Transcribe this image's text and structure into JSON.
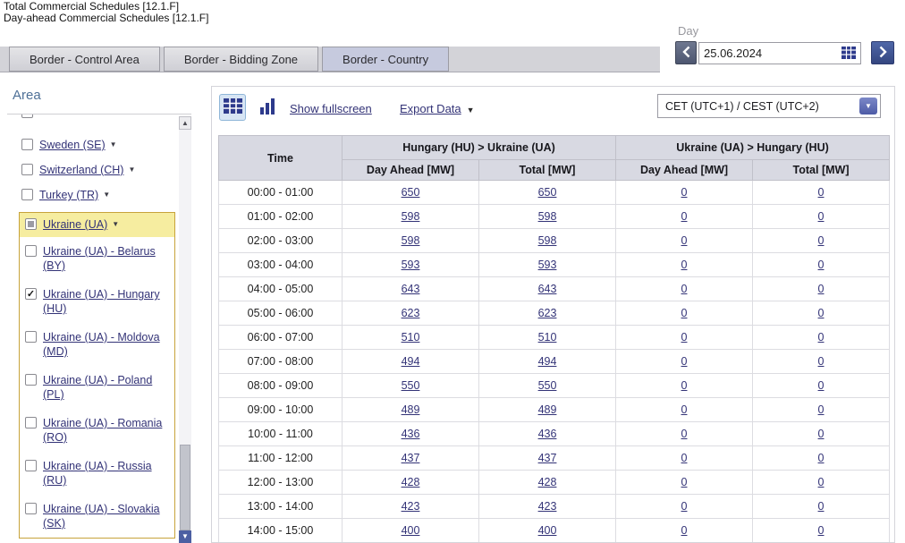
{
  "page": {
    "title_line1": "Total Commercial Schedules [12.1.F]",
    "title_line2": "Day-ahead Commercial Schedules [12.1.F]"
  },
  "datepicker": {
    "label": "Day",
    "value": "25.06.2024"
  },
  "tabs": [
    {
      "label": "Border - Control Area",
      "active": false
    },
    {
      "label": "Border - Bidding Zone",
      "active": false
    },
    {
      "label": "Border - Country",
      "active": true
    }
  ],
  "sidebar": {
    "title": "Area",
    "items_before": [
      {
        "label": "Sweden (SE)",
        "checked": false
      },
      {
        "label": "Switzerland (CH)",
        "checked": false
      },
      {
        "label": "Turkey (TR)",
        "checked": false
      }
    ],
    "group_parent": {
      "label": "Ukraine (UA)",
      "checked": "partial",
      "highlighted": true
    },
    "group_items": [
      {
        "label": "Ukraine (UA) - Belarus (BY)",
        "checked": false
      },
      {
        "label": "Ukraine (UA) - Hungary (HU)",
        "checked": true
      },
      {
        "label": "Ukraine (UA) - Moldova (MD)",
        "checked": false
      },
      {
        "label": "Ukraine (UA) - Poland (PL)",
        "checked": false
      },
      {
        "label": "Ukraine (UA) - Romania (RO)",
        "checked": false
      },
      {
        "label": "Ukraine (UA) - Russia (RU)",
        "checked": false
      },
      {
        "label": "Ukraine (UA) - Slovakia (SK)",
        "checked": false
      }
    ]
  },
  "toolbar": {
    "show_fullscreen": "Show fullscreen",
    "export_data": "Export Data",
    "timezone": "CET (UTC+1) / CEST (UTC+2)"
  },
  "table": {
    "time_header": "Time",
    "group1": "Hungary (HU) > Ukraine (UA)",
    "group2": "Ukraine (UA) > Hungary (HU)",
    "sub_headers": [
      "Day Ahead [MW]",
      "Total [MW]",
      "Day Ahead [MW]",
      "Total [MW]"
    ],
    "rows": [
      {
        "time": "00:00 - 01:00",
        "values": [
          "650",
          "650",
          "0",
          "0"
        ]
      },
      {
        "time": "01:00 - 02:00",
        "values": [
          "598",
          "598",
          "0",
          "0"
        ]
      },
      {
        "time": "02:00 - 03:00",
        "values": [
          "598",
          "598",
          "0",
          "0"
        ]
      },
      {
        "time": "03:00 - 04:00",
        "values": [
          "593",
          "593",
          "0",
          "0"
        ]
      },
      {
        "time": "04:00 - 05:00",
        "values": [
          "643",
          "643",
          "0",
          "0"
        ]
      },
      {
        "time": "05:00 - 06:00",
        "values": [
          "623",
          "623",
          "0",
          "0"
        ]
      },
      {
        "time": "06:00 - 07:00",
        "values": [
          "510",
          "510",
          "0",
          "0"
        ]
      },
      {
        "time": "07:00 - 08:00",
        "values": [
          "494",
          "494",
          "0",
          "0"
        ]
      },
      {
        "time": "08:00 - 09:00",
        "values": [
          "550",
          "550",
          "0",
          "0"
        ]
      },
      {
        "time": "09:00 - 10:00",
        "values": [
          "489",
          "489",
          "0",
          "0"
        ]
      },
      {
        "time": "10:00 - 11:00",
        "values": [
          "436",
          "436",
          "0",
          "0"
        ]
      },
      {
        "time": "11:00 - 12:00",
        "values": [
          "437",
          "437",
          "0",
          "0"
        ]
      },
      {
        "time": "12:00 - 13:00",
        "values": [
          "428",
          "428",
          "0",
          "0"
        ]
      },
      {
        "time": "13:00 - 14:00",
        "values": [
          "423",
          "423",
          "0",
          "0"
        ]
      },
      {
        "time": "14:00 - 15:00",
        "values": [
          "400",
          "400",
          "0",
          "0"
        ]
      }
    ]
  },
  "icons": {
    "table_view": "grid-table-icon",
    "chart_view": "bar-chart-icon",
    "calendar": "calendar-grid-icon",
    "chevron_down": "▼",
    "chevron_up": "▲",
    "checkmark": "✓"
  },
  "colors": {
    "link_color": "#333377",
    "accent_navy": "#2d3a8c",
    "highlight_bg": "#f6eda0",
    "highlight_border": "#c7a33b",
    "table_header_bg": "#d8d9e2",
    "tab_active_bg": "#c6cade"
  }
}
